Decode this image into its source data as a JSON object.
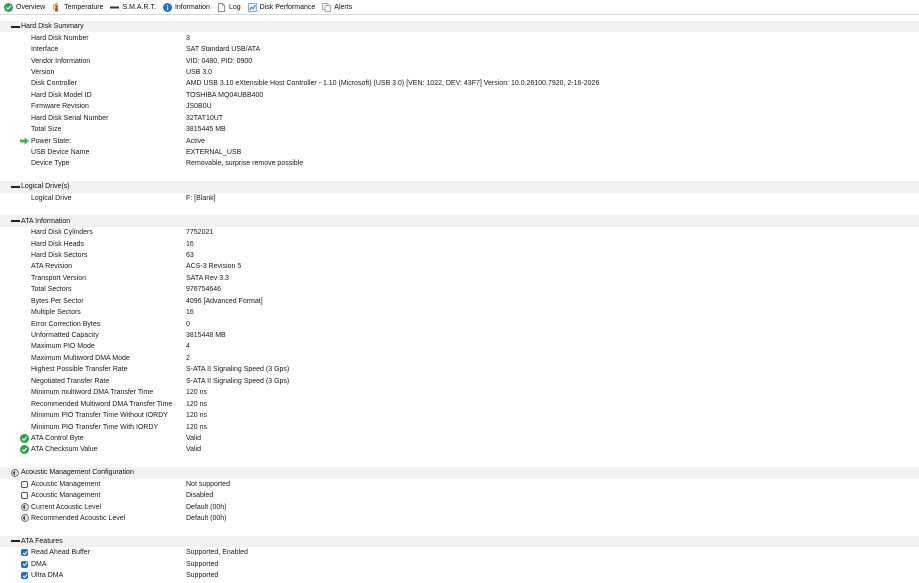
{
  "toolbar": {
    "tabs": [
      {
        "label": "Overview",
        "icon": "check-circle-green-icon"
      },
      {
        "label": "Temperature",
        "icon": "thermometer-icon"
      },
      {
        "label": "S.M.A.R.T.",
        "icon": "drive-icon"
      },
      {
        "label": "Information",
        "icon": "info-icon"
      },
      {
        "label": "Log",
        "icon": "document-icon"
      },
      {
        "label": "Disk Performance",
        "icon": "chart-icon"
      },
      {
        "label": "Alerts",
        "icon": "copy-alert-icon"
      }
    ]
  },
  "sections": {
    "summary": {
      "title": "Hard Disk Summary",
      "rows": [
        {
          "key": "Hard Disk Number",
          "value": "3"
        },
        {
          "key": "Interface",
          "value": "SAT Standard USB/ATA"
        },
        {
          "key": "Vendor Information",
          "value": "VID: 0480, PID: 0900"
        },
        {
          "key": "Version",
          "value": "USB 3.0"
        },
        {
          "key": "Disk Controller",
          "value": "AMD USB 3.10 eXtensible Host Controller - 1.10 (Microsoft) (USB 3.0) [VEN: 1022, DEV: 43F7] Version: 10.0.26100.7920, 2-16-2026"
        },
        {
          "key": "Hard Disk Model ID",
          "value": "TOSHIBA MQ04UBB400"
        },
        {
          "key": "Firmware Revision",
          "value": "JS0B0U"
        },
        {
          "key": "Hard Disk Serial Number",
          "value": "32TAT10UT"
        },
        {
          "key": "Total Size",
          "value": "3815445 MB"
        },
        {
          "key": "Power State:",
          "value": "Active",
          "icon": "arrow-right-green-icon"
        },
        {
          "key": "USB Device Name",
          "value": "EXTERNAL_USB"
        },
        {
          "key": "Device Type",
          "value": "Removable, surprise remove possible"
        }
      ]
    },
    "logical": {
      "title": "Logical Drive(s)",
      "rows": [
        {
          "key": "Logical Drive",
          "value": "F: [Blank]"
        }
      ]
    },
    "ata": {
      "title": "ATA Information",
      "rows": [
        {
          "key": "Hard Disk Cylinders",
          "value": "7752021"
        },
        {
          "key": "Hard Disk Heads",
          "value": "16"
        },
        {
          "key": "Hard Disk Sectors",
          "value": "63"
        },
        {
          "key": "ATA Revision",
          "value": "ACS-3 Revision 5"
        },
        {
          "key": "Transport Version",
          "value": "SATA Rev 3.3"
        },
        {
          "key": "Total Sectors",
          "value": "976754646"
        },
        {
          "key": "Bytes Per Sector",
          "value": "4096 [Advanced Format]"
        },
        {
          "key": "Multiple Sectors",
          "value": "16"
        },
        {
          "key": "Error Correction Bytes",
          "value": "0"
        },
        {
          "key": "Unformatted Capacity",
          "value": "3815448 MB"
        },
        {
          "key": "Maximum PIO Mode",
          "value": "4"
        },
        {
          "key": "Maximum Multiword DMA Mode",
          "value": "2"
        },
        {
          "key": "Highest Possible Transfer Rate",
          "value": "S-ATA II Signaling Speed (3 Gps)"
        },
        {
          "key": "Negotiated Transfer Rate",
          "value": "S-ATA II Signaling Speed (3 Gps)"
        },
        {
          "key": "Minimum multiword DMA Transfer Time",
          "value": "120 ns"
        },
        {
          "key": "Recommended Multiword DMA Transfer Time",
          "value": "120 ns"
        },
        {
          "key": "Minimum PIO Transfer Time Without IORDY",
          "value": "120 ns"
        },
        {
          "key": "Minimum PIO Transfer Time With IORDY",
          "value": "120 ns"
        },
        {
          "key": "ATA Control Byte",
          "value": "Valid",
          "icon": "check-circle-green-icon"
        },
        {
          "key": "ATA Checksum Value",
          "value": "Valid",
          "icon": "check-circle-green-icon"
        }
      ]
    },
    "acoustic": {
      "title": "Acoustic Management Configuration",
      "title_icon": "speaker-icon",
      "rows": [
        {
          "key": "Acoustic Management",
          "value": "Not supported",
          "icon": "checkbox-empty-icon"
        },
        {
          "key": "Acoustic Management",
          "value": "Disabled",
          "icon": "checkbox-empty-icon"
        },
        {
          "key": "Current Acoustic Level",
          "value": "Default (00h)",
          "icon": "speaker-icon"
        },
        {
          "key": "Recommended Acoustic Level",
          "value": "Default (00h)",
          "icon": "speaker-icon"
        }
      ]
    },
    "features": {
      "title": "ATA Features",
      "rows": [
        {
          "key": "Read Ahead Buffer",
          "value": "Supported, Enabled",
          "icon": "checkbox-checked-icon"
        },
        {
          "key": "DMA",
          "value": "Supported",
          "icon": "checkbox-checked-icon"
        },
        {
          "key": "Ultra DMA",
          "value": "Supported",
          "icon": "checkbox-checked-icon"
        }
      ]
    }
  },
  "colors": {
    "accent_blue": "#1f6fd1",
    "ok_green": "#26a64a",
    "section_bg": "#f2f2f2"
  }
}
